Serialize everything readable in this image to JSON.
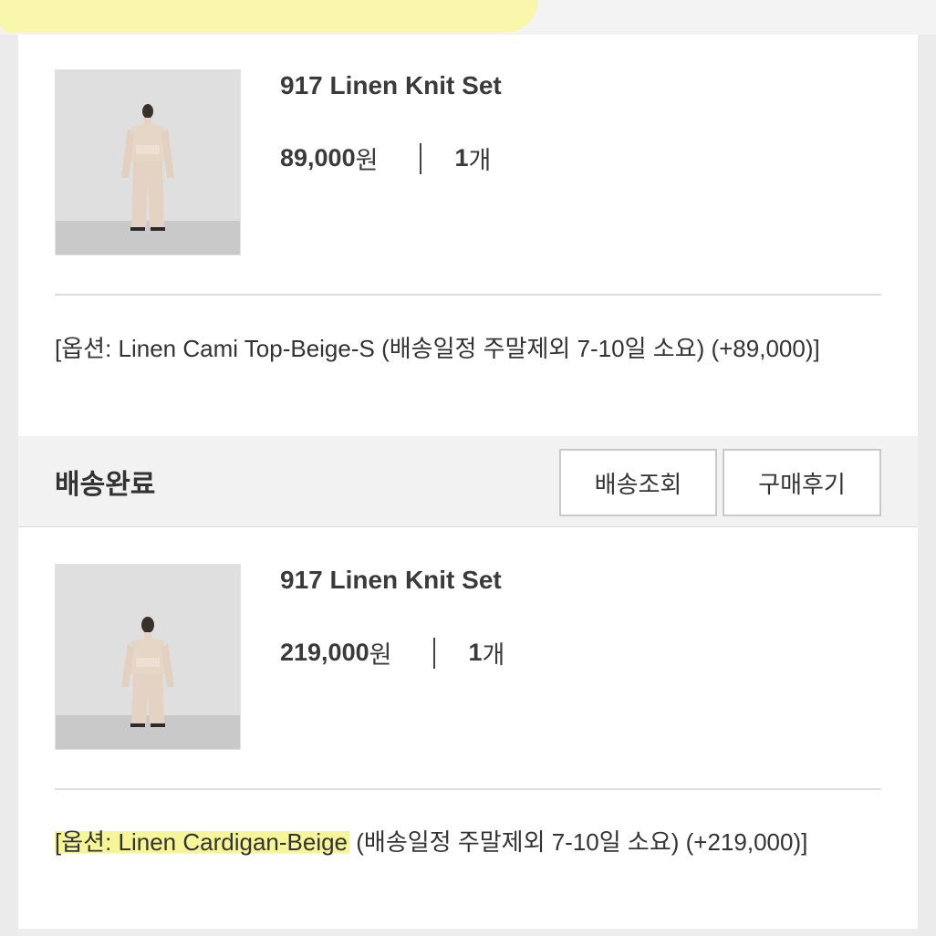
{
  "orders": [
    {
      "product_name": "917 Linen Knit Set",
      "price": "89,000",
      "price_unit": "원",
      "quantity": "1",
      "quantity_unit": "개",
      "option_prefix": "[옵션: Linen Cami Top-Beige-S",
      "option_rest": " (배송일정 주말제외 7-10일 소요) (+89,000)]"
    },
    {
      "product_name": "917 Linen Knit Set",
      "price": "219,000",
      "price_unit": "원",
      "quantity": "1",
      "quantity_unit": "개",
      "option_prefix": "[옵션: Linen Cardigan-Beige",
      "option_rest": " (배송일정 주말제외 7-10일 소요) (+219,000)]"
    }
  ],
  "status_bar": {
    "status": "배송완료",
    "track_button": "배송조회",
    "review_button": "구매후기"
  },
  "colors": {
    "highlight": "#f6f59a",
    "background": "#ebebeb",
    "card": "#ffffff",
    "text": "#333333"
  }
}
